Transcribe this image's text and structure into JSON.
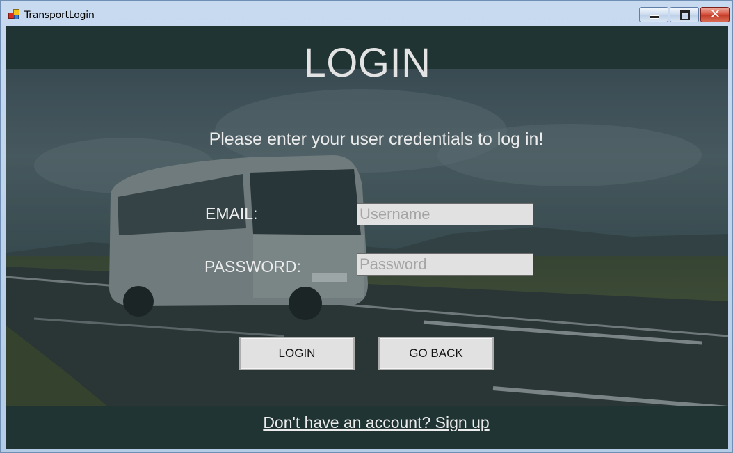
{
  "window": {
    "title": "TransportLogin",
    "controls": {
      "minimize": "minimize",
      "maximize": "maximize",
      "close": "✕"
    }
  },
  "header": {
    "title": "LOGIN"
  },
  "form": {
    "instructions": "Please enter your user credentials to log in!",
    "email_label": "EMAIL:",
    "email_placeholder": "Username",
    "email_value": "",
    "password_label": "PASSWORD:",
    "password_placeholder": "Password",
    "password_value": ""
  },
  "buttons": {
    "login": "LOGIN",
    "go_back": "GO BACK"
  },
  "footer": {
    "signup_link": "Don't have an account? Sign up"
  },
  "colors": {
    "band": "#203434",
    "text": "#ececec",
    "field_bg": "#e1e1e1",
    "button_bg": "#e1e1e1"
  },
  "icons": {
    "app": "app-window-icon"
  }
}
